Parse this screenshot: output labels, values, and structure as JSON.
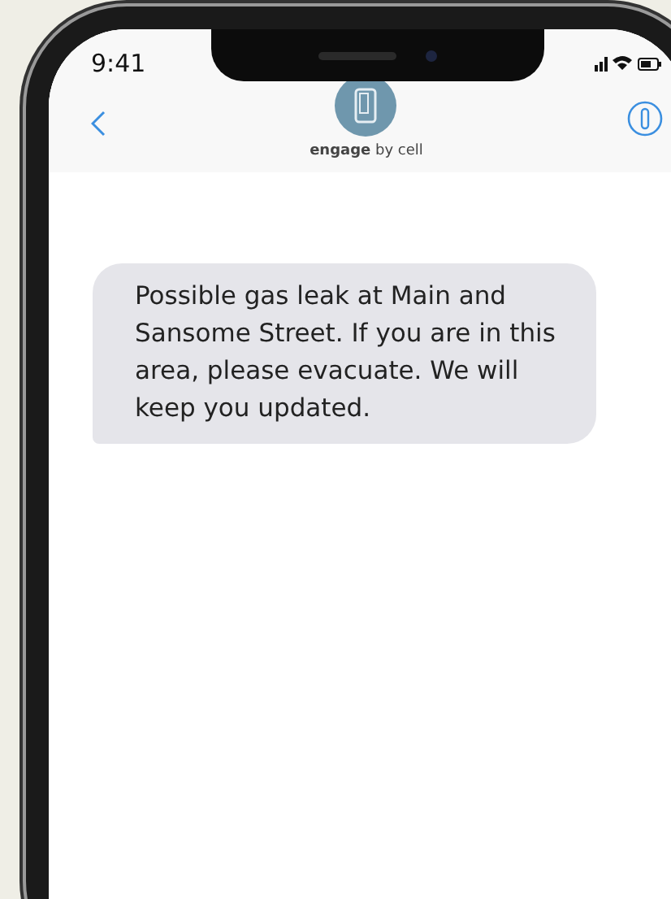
{
  "status_bar": {
    "time": "9:41"
  },
  "header": {
    "brand": "**engage** by cell"
  },
  "messages": [
    {
      "text": "Possible gas leak at Main and Sansome Street. If you are in this area, please evacuate. We will keep you updated.",
      "incoming": true
    }
  ]
}
